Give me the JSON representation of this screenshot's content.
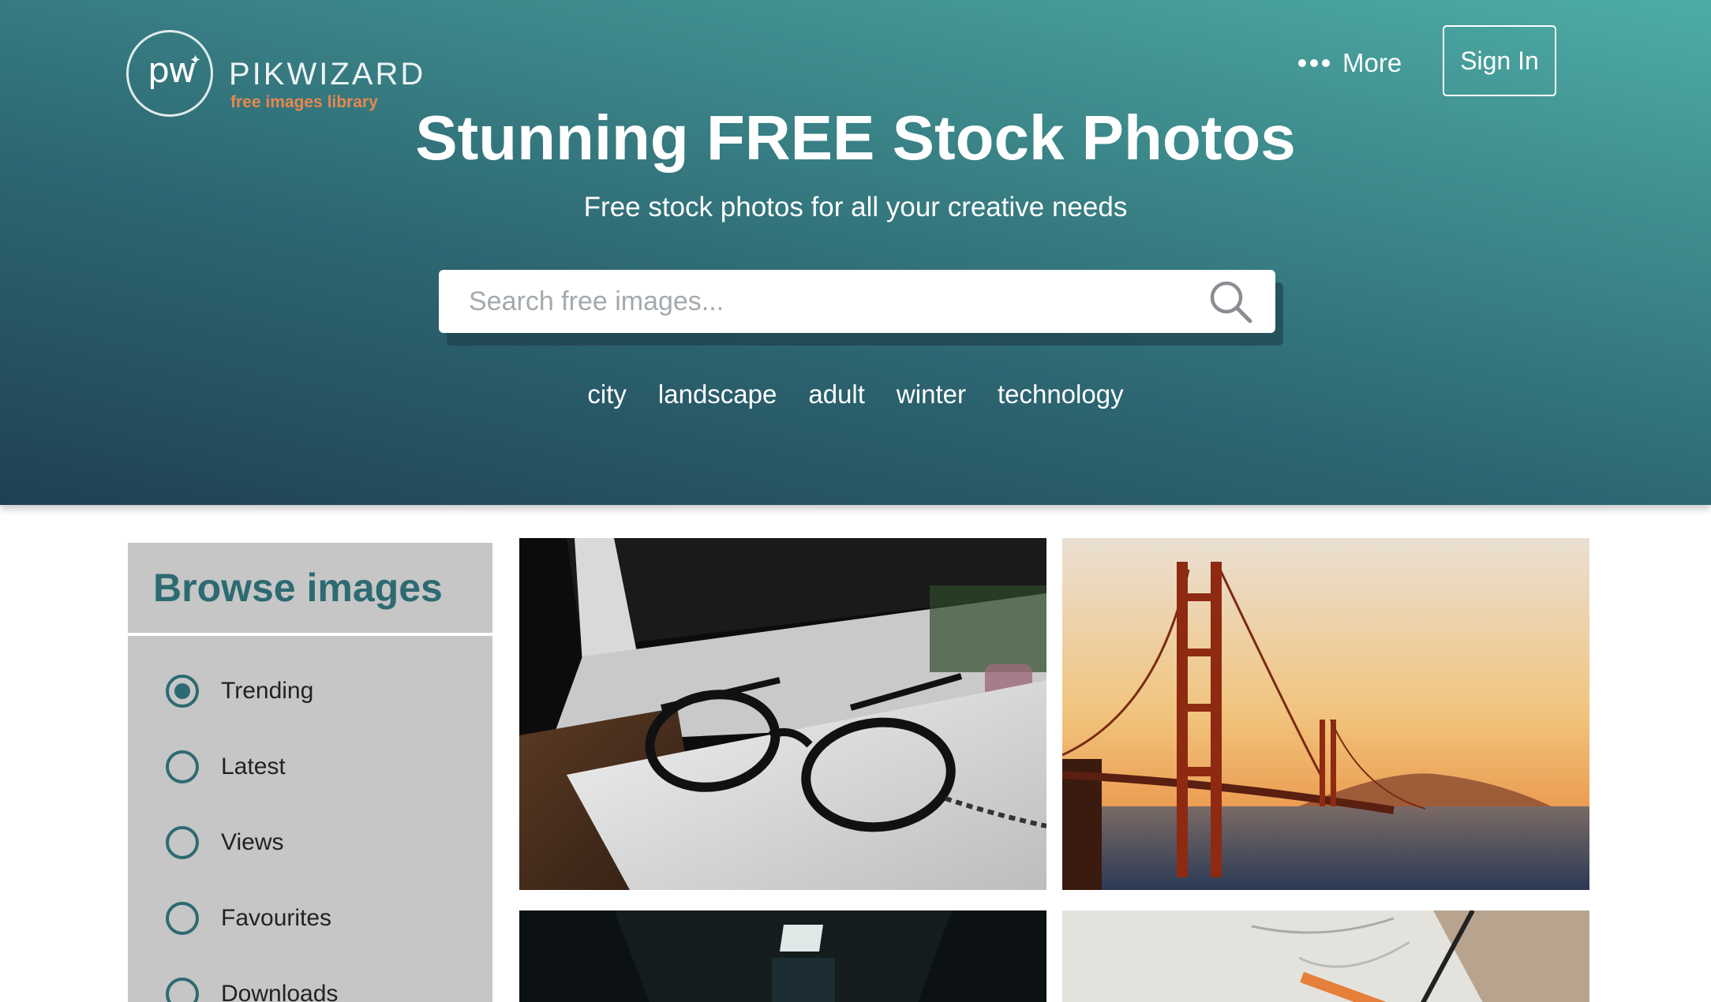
{
  "brand": {
    "logo_mark": "pw",
    "name": "PIKWIZARD",
    "tagline": "free images library"
  },
  "nav": {
    "more_label": "More",
    "signin_label": "Sign In"
  },
  "hero": {
    "title_pre": "Stunning ",
    "title_bold": "FREE",
    "title_post": " Stock Photos",
    "subtitle": "Free stock photos for all your creative needs",
    "search_placeholder": "Search free images...",
    "tags": [
      "city",
      "landscape",
      "adult",
      "winter",
      "technology"
    ]
  },
  "browse": {
    "title": "Browse images",
    "options": [
      {
        "label": "Trending",
        "selected": true
      },
      {
        "label": "Latest",
        "selected": false
      },
      {
        "label": "Views",
        "selected": false
      },
      {
        "label": "Favourites",
        "selected": false
      },
      {
        "label": "Downloads",
        "selected": false
      }
    ]
  },
  "photos": [
    {
      "subject": "eyeglasses on notebook"
    },
    {
      "subject": "golden gate bridge at sunset"
    },
    {
      "subject": "dark corridor with ceiling light"
    },
    {
      "subject": "sketchbook with pencil"
    }
  ],
  "colors": {
    "accent": "#2d6a72",
    "logo_tagline": "#e6884e",
    "panel_bg": "#c6c6c6"
  }
}
